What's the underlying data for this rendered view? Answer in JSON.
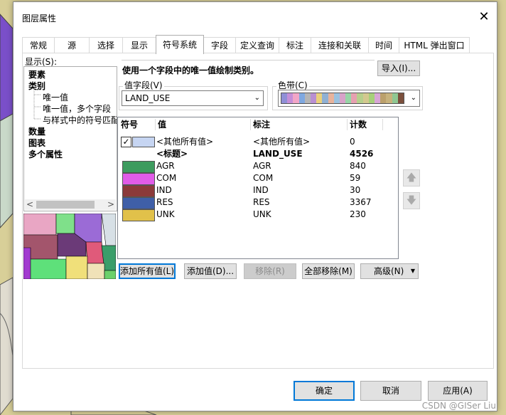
{
  "dialog": {
    "title": "图层属性",
    "close_glyph": "✕"
  },
  "tabs": [
    {
      "label": "常规"
    },
    {
      "label": "源"
    },
    {
      "label": "选择"
    },
    {
      "label": "显示"
    },
    {
      "label": "符号系统",
      "active": true
    },
    {
      "label": "字段"
    },
    {
      "label": "定义查询"
    },
    {
      "label": "标注"
    },
    {
      "label": "连接和关联"
    },
    {
      "label": "时间"
    },
    {
      "label": "HTML 弹出窗口"
    }
  ],
  "show": {
    "label": "显示(S):",
    "items": [
      "要素",
      "类别",
      "唯一值",
      "唯一值，多个字段",
      "与样式中的符号匹配",
      "数量",
      "图表",
      "多个属性"
    ]
  },
  "heading": "使用一个字段中的唯一值绘制类别。",
  "import_button": "导入(I)...",
  "value_field": {
    "label": "值字段(V)",
    "value": "LAND_USE"
  },
  "color_ramp": {
    "label": "色带(C)",
    "colors": [
      "#8f8fd6",
      "#c58fd8",
      "#f2a6c7",
      "#7fa8e0",
      "#b5b5b5",
      "#b98fd2",
      "#ead07c",
      "#8fb0d3",
      "#e8b39b",
      "#9bc2df",
      "#d7a2c9",
      "#97d5a6",
      "#e6a0b0",
      "#b6cf8c",
      "#d3c88f",
      "#a7d07a",
      "#d8a6d6",
      "#bba06b",
      "#c7b27c",
      "#8fc792",
      "#7b4f3c"
    ]
  },
  "table": {
    "headers": [
      "符号",
      "值",
      "标注",
      "计数"
    ],
    "rows": [
      {
        "value": "<其他所有值>",
        "label": "<其他所有值>",
        "count": "0",
        "color": "#c6d5f2",
        "checked": true
      },
      {
        "value": "<标题>",
        "label": "LAND_USE",
        "count": "4526",
        "bold": true
      },
      {
        "value": "AGR",
        "label": "AGR",
        "count": "840",
        "color": "#3d9b5e"
      },
      {
        "value": "COM",
        "label": "COM",
        "count": "59",
        "color": "#e15ce8"
      },
      {
        "value": "IND",
        "label": "IND",
        "count": "30",
        "color": "#8b3a3a"
      },
      {
        "value": "RES",
        "label": "RES",
        "count": "3367",
        "color": "#3f5fa8"
      },
      {
        "value": "UNK",
        "label": "UNK",
        "count": "230",
        "color": "#e1c14a"
      }
    ]
  },
  "buttons": {
    "add_all": "添加所有值(L)",
    "add": "添加值(D)...",
    "remove": "移除(R)",
    "remove_all": "全部移除(M)",
    "advanced": "高级(N)"
  },
  "footer": {
    "ok": "确定",
    "cancel": "取消",
    "apply": "应用(A)"
  },
  "watermark": "CSDN @GISer Liu"
}
